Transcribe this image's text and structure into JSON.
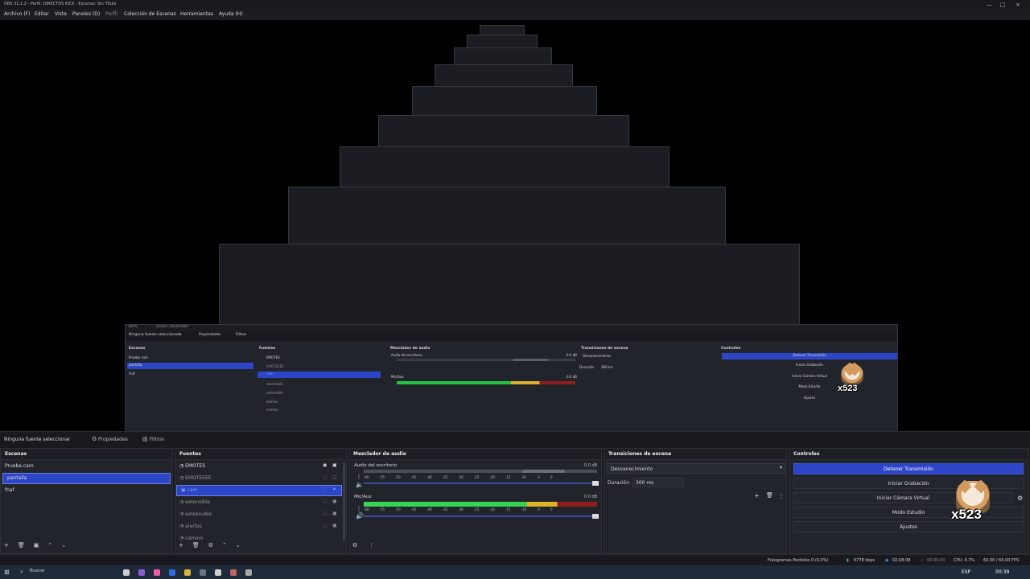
{
  "window": {
    "title": "OBS 31.1.2 - Perfil: DIRECTOS KICK - Escenas: Sin Título"
  },
  "menu": [
    "Archivo (F)",
    "Editar",
    "Vista",
    "Paneles (D)",
    "Perfil",
    "Colección de Escenas",
    "Herramientas",
    "Ayuda (H)"
  ],
  "nested_preview": {
    "status_small": "100%",
    "resolution": "Lienzo (1920x1080)",
    "no_source": "Ninguna fuente seleccionada",
    "properties": "Propiedades",
    "filters": "Filtros",
    "scenes": "Escenas",
    "sources": "Fuentes",
    "audio": "Mezclador de audio",
    "transitions": "Transiciones de escena",
    "controls": "Controles",
    "scene_items": [
      "Prueba cam",
      "pantalla",
      "fnaf"
    ],
    "source_items": [
      "EMOTES",
      "EMOTEEEE",
      "cam",
      "extensible",
      "extensible",
      "alertas",
      "camino"
    ],
    "audio_tracks": [
      "Audio del escritorio",
      "Mic/Aux"
    ],
    "audio_levels": [
      "0.0 dB",
      "0.0 dB"
    ],
    "transition_value": "Desvanecimiento",
    "duration_label": "Duración",
    "duration_value": "300 ms",
    "buttons": [
      "Detener Transmisión",
      "Iniciar Grabación",
      "Iniciar Cámara Virtual",
      "Modo Estudio",
      "Ajustes"
    ],
    "overlay": "x523"
  },
  "subbar": {
    "no_source": "Ninguna fuente seleccionar",
    "properties": "Propiedades",
    "filters": "Filtros"
  },
  "scenes": {
    "title": "Escenas",
    "items": [
      "Prueba cam",
      "pantalla",
      "fnaf"
    ],
    "selected": 1
  },
  "sources": {
    "title": "Fuentes",
    "items": [
      "EMOTES",
      "EMOTEEEE",
      "cam",
      "extensible",
      "extesnuble",
      "alertas",
      "camino"
    ],
    "selected": 2
  },
  "audio": {
    "title": "Mezclador de audio",
    "tracks": [
      {
        "name": "Audio del escritorio",
        "db": "0.0 dB"
      },
      {
        "name": "Mic/Aux",
        "db": "0.0 dB"
      }
    ],
    "scale": [
      "-60",
      "-55",
      "-50",
      "-45",
      "-40",
      "-35",
      "-30",
      "-25",
      "-20",
      "-15",
      "-10",
      "-5",
      "0"
    ]
  },
  "transitions": {
    "title": "Transiciones de escena",
    "selected": "Desvanecimiento",
    "duration_label": "Duración",
    "duration_value": "300 ms"
  },
  "controls": {
    "title": "Controles",
    "buttons": [
      "Detener Transmisión",
      "Iniciar Grabación",
      "Iniciar Cámara Virtual",
      "Modo Estudio",
      "Ajustes"
    ],
    "overlay_text": "x523"
  },
  "status": {
    "dropped": "Fotogramas Perdidos 0 (0.0%)",
    "bitrate": "6778 kbps",
    "time": "02:08:08",
    "record_time": "00:00:00",
    "cpu": "CPU: 4.7%",
    "fps": "60.00 / 60.00 FPS"
  },
  "taskbar": {
    "search": "Buscar",
    "lang": "ESP",
    "clock": "00:39"
  },
  "colors": {
    "accent": "#2d45c7",
    "panel": "#22242b",
    "background": "#1b1c21"
  }
}
